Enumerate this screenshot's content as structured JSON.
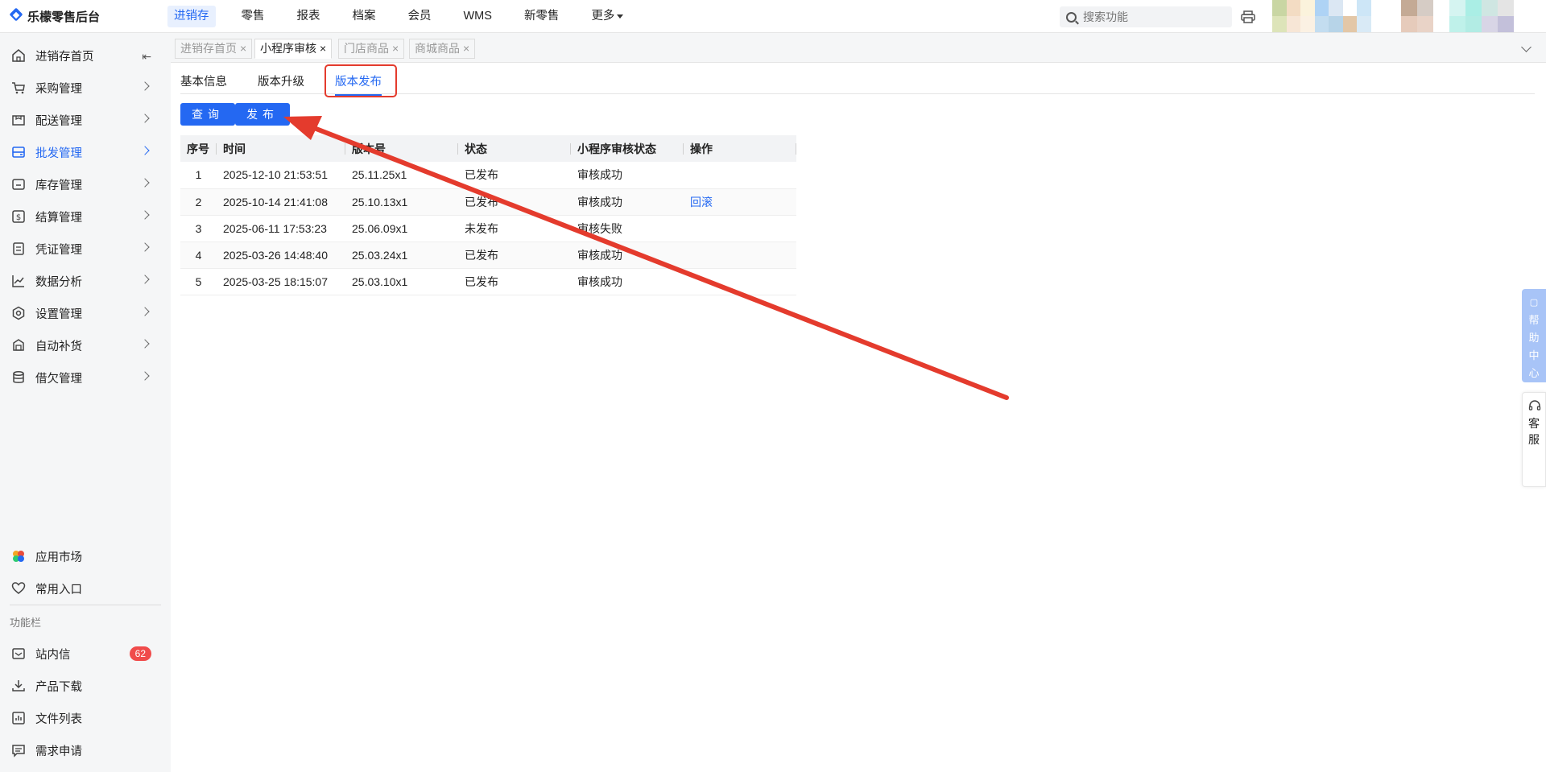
{
  "app": {
    "title": "乐檬零售后台"
  },
  "topnav": [
    "进销存",
    "零售",
    "报表",
    "档案",
    "会员",
    "WMS",
    "新零售",
    "更多"
  ],
  "search": {
    "placeholder": "搜索功能"
  },
  "sidebar": {
    "items": [
      "进销存首页",
      "采购管理",
      "配送管理",
      "批发管理",
      "库存管理",
      "结算管理",
      "凭证管理",
      "数据分析",
      "设置管理",
      "自动补货",
      "借欠管理"
    ],
    "bottom_items": [
      "应用市场",
      "常用入口"
    ],
    "section_label": "功能栏",
    "func_items": [
      "站内信",
      "产品下载",
      "文件列表",
      "需求申请"
    ],
    "mail_badge": "62"
  },
  "page_tabs": [
    "进销存首页",
    "小程序审核",
    "门店商品",
    "商城商品"
  ],
  "sub_tabs": [
    "基本信息",
    "版本升级",
    "版本发布"
  ],
  "buttons": {
    "query": "查询",
    "publish": "发布"
  },
  "table": {
    "headers": [
      "序号",
      "时间",
      "版本号",
      "状态",
      "小程序审核状态",
      "操作"
    ],
    "rows": [
      [
        "1",
        "2025-12-10 21:53:51",
        "25.11.25x1",
        "已发布",
        "审核成功",
        ""
      ],
      [
        "2",
        "2025-10-14 21:41:08",
        "25.10.13x1",
        "已发布",
        "审核成功",
        "回滚"
      ],
      [
        "3",
        "2025-06-11 17:53:23",
        "25.06.09x1",
        "未发布",
        "审核失败",
        ""
      ],
      [
        "4",
        "2025-03-26 14:48:40",
        "25.03.24x1",
        "已发布",
        "审核成功",
        ""
      ],
      [
        "5",
        "2025-03-25 18:15:07",
        "25.03.10x1",
        "已发布",
        "审核成功",
        ""
      ]
    ]
  },
  "float": {
    "help": "帮助中心",
    "service": "客服"
  },
  "colors": {
    "primary": "#2468f2",
    "annotation": "#e43b2d",
    "badge": "#f04b4b"
  }
}
